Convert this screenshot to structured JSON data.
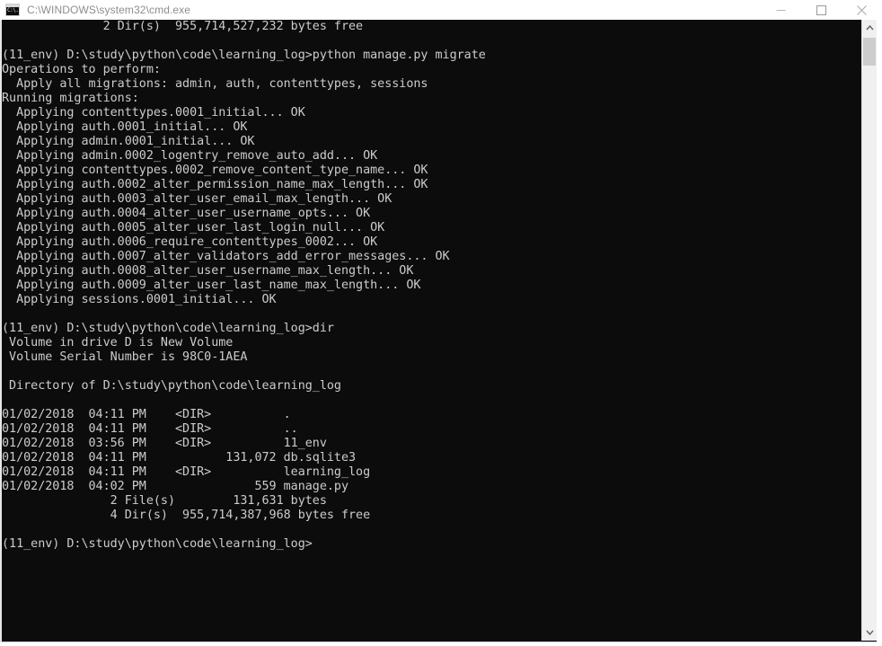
{
  "window": {
    "title": "C:\\WINDOWS\\system32\\cmd.exe",
    "icon": "cmd-console-icon",
    "icon_glyph": "C:\\.",
    "colors": {
      "titlebar_bg": "#ffffff",
      "titlebar_text": "#8d8d8d",
      "console_bg": "#0c0c0c",
      "console_text": "#cccccc",
      "scrollbar_track": "#f0f0f0",
      "scrollbar_thumb": "#cdcdcd"
    },
    "controls": {
      "minimize_label": "Minimize",
      "maximize_label": "Maximize",
      "close_label": "Close"
    }
  },
  "scrollbar": {
    "up_arrow_label": "Scroll up",
    "down_arrow_label": "Scroll down",
    "thumb_label": "Scroll thumb"
  },
  "console": {
    "prompt": "(11_env) D:\\study\\python\\code\\learning_log>",
    "commands": [
      "python manage.py migrate",
      "dir"
    ],
    "text": "              2 Dir(s)  955,714,527,232 bytes free\n\n(11_env) D:\\study\\python\\code\\learning_log>python manage.py migrate\nOperations to perform:\n  Apply all migrations: admin, auth, contenttypes, sessions\nRunning migrations:\n  Applying contenttypes.0001_initial... OK\n  Applying auth.0001_initial... OK\n  Applying admin.0001_initial... OK\n  Applying admin.0002_logentry_remove_auto_add... OK\n  Applying contenttypes.0002_remove_content_type_name... OK\n  Applying auth.0002_alter_permission_name_max_length... OK\n  Applying auth.0003_alter_user_email_max_length... OK\n  Applying auth.0004_alter_user_username_opts... OK\n  Applying auth.0005_alter_user_last_login_null... OK\n  Applying auth.0006_require_contenttypes_0002... OK\n  Applying auth.0007_alter_validators_add_error_messages... OK\n  Applying auth.0008_alter_user_username_max_length... OK\n  Applying auth.0009_alter_user_last_name_max_length... OK\n  Applying sessions.0001_initial... OK\n\n(11_env) D:\\study\\python\\code\\learning_log>dir\n Volume in drive D is New Volume\n Volume Serial Number is 98C0-1AEA\n\n Directory of D:\\study\\python\\code\\learning_log\n\n01/02/2018  04:11 PM    <DIR>          .\n01/02/2018  04:11 PM    <DIR>          ..\n01/02/2018  03:56 PM    <DIR>          11_env\n01/02/2018  04:11 PM           131,072 db.sqlite3\n01/02/2018  04:11 PM    <DIR>          learning_log\n01/02/2018  04:02 PM               559 manage.py\n               2 File(s)        131,631 bytes\n               4 Dir(s)  955,714,387,968 bytes free\n\n(11_env) D:\\study\\python\\code\\learning_log>"
  }
}
